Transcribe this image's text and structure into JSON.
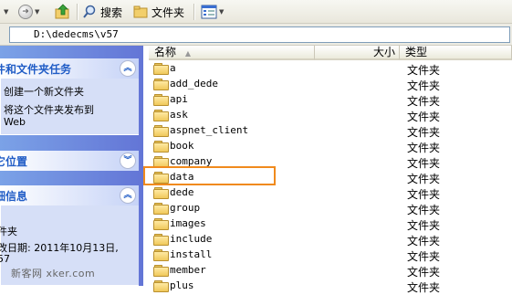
{
  "toolbar": {
    "search_label": "搜索",
    "folders_label": "文件夹"
  },
  "address": {
    "path": "D:\\dedecms\\v57"
  },
  "leftpane": {
    "tasks_panel": {
      "title": "件和文件夹任务",
      "items": [
        {
          "label": "创建一个新文件夹"
        },
        {
          "label_line1": "将这个文件夹发布到",
          "label_line2": "Web"
        }
      ]
    },
    "places_panel": {
      "title": "它位置"
    },
    "details_panel": {
      "title": "细信息",
      "lines": [
        "件夹",
        "改日期: 2011年10月13日,",
        "57"
      ]
    },
    "watermark": "新客网 xker.com"
  },
  "filelist": {
    "columns": {
      "name": "名称",
      "size": "大小",
      "type": "类型"
    },
    "rows": [
      {
        "name": "a",
        "type": "文件夹"
      },
      {
        "name": "add_dede",
        "type": "文件夹"
      },
      {
        "name": "api",
        "type": "文件夹"
      },
      {
        "name": "ask",
        "type": "文件夹"
      },
      {
        "name": "aspnet_client",
        "type": "文件夹"
      },
      {
        "name": "book",
        "type": "文件夹"
      },
      {
        "name": "company",
        "type": "文件夹"
      },
      {
        "name": "data",
        "type": "文件夹",
        "highlighted": true
      },
      {
        "name": "dede",
        "type": "文件夹"
      },
      {
        "name": "group",
        "type": "文件夹"
      },
      {
        "name": "images",
        "type": "文件夹"
      },
      {
        "name": "include",
        "type": "文件夹"
      },
      {
        "name": "install",
        "type": "文件夹"
      },
      {
        "name": "member",
        "type": "文件夹"
      },
      {
        "name": "plus",
        "type": "文件夹"
      }
    ]
  },
  "colors": {
    "highlight_border": "#f08a1d",
    "panel_title": "#215dc6",
    "taskpane_bg": "#6375d6"
  }
}
